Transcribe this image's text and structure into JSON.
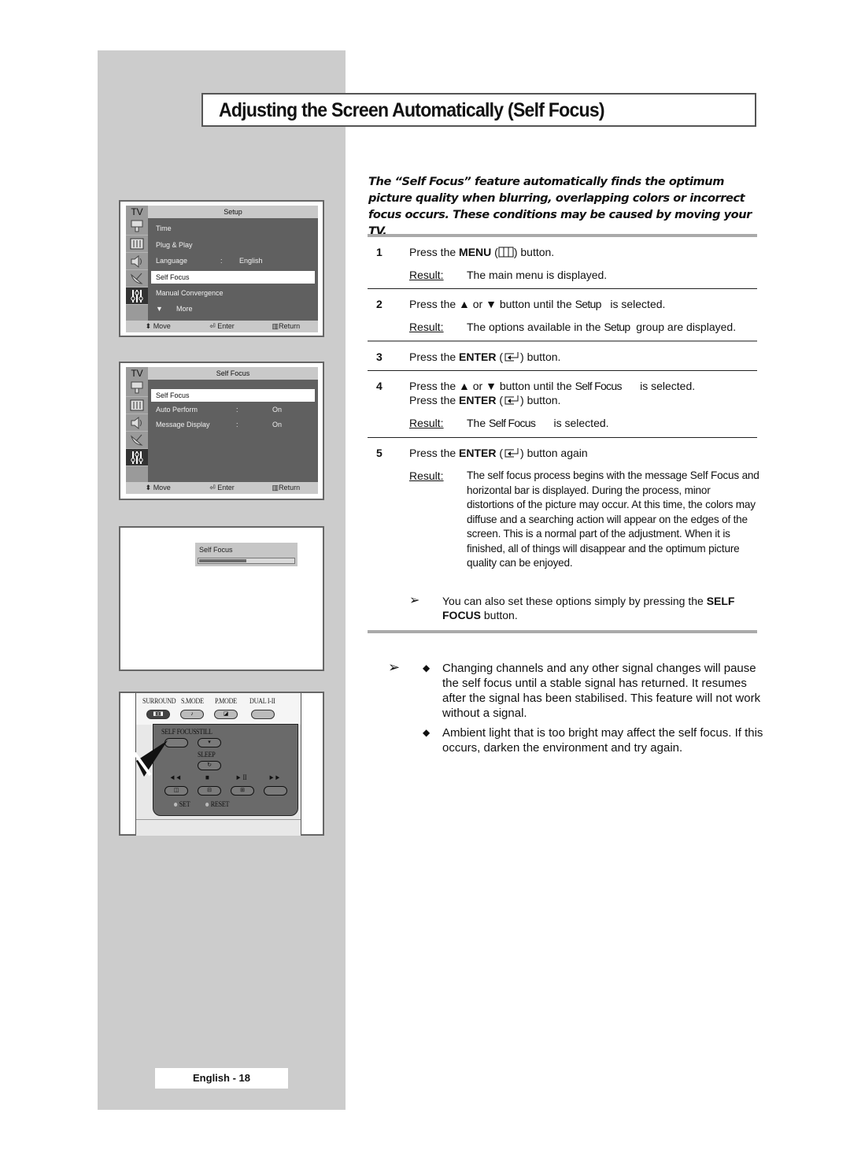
{
  "page": {
    "title": "Adjusting the Screen Automatically (Self Focus)",
    "intro": "The “Self Focus” feature automatically finds the optimum picture quality when blurring, overlapping colors or incorrect focus occurs. These conditions may be caused by moving your TV.",
    "footer": "English - 18"
  },
  "osd_setup": {
    "tv_label": "TV",
    "title": "Setup",
    "icons": [
      "antenna-input-icon",
      "picture-menu-icon",
      "speaker-icon",
      "satellite-dish-icon",
      "sliders-icon"
    ],
    "items": [
      {
        "label": "Time",
        "sep": "",
        "value": ""
      },
      {
        "label": "Plug & Play",
        "sep": "",
        "value": ""
      },
      {
        "label": "Language",
        "sep": ":",
        "value": "English"
      },
      {
        "label": "Self Focus",
        "sep": "",
        "value": "",
        "selected": true
      },
      {
        "label": "Manual Convergence",
        "sep": "",
        "value": ""
      },
      {
        "label": "More",
        "sep": "",
        "value": ""
      }
    ],
    "footer": {
      "move": "Move",
      "enter": "Enter",
      "return": "Return"
    }
  },
  "osd_selffocus": {
    "tv_label": "TV",
    "title": "Self Focus",
    "items": [
      {
        "label": "Self Focus",
        "sep": "",
        "value": "",
        "selected": true
      },
      {
        "label": "Auto Perform",
        "sep": ":",
        "value": "On"
      },
      {
        "label": "Message Display",
        "sep": ":",
        "value": "On"
      }
    ],
    "footer": {
      "move": "Move",
      "enter": "Enter",
      "return": "Return"
    }
  },
  "progress_popup": {
    "label": "Self Focus",
    "progress_percent": 50
  },
  "remote": {
    "top_labels": [
      "SURROUND",
      "S.MODE",
      "P.MODE",
      "DUAL I-II"
    ],
    "self_focus": "SELF FOCUS",
    "still": "STILL",
    "sleep": "SLEEP",
    "transport": [
      "◄◄",
      "■",
      "► II",
      "►►"
    ],
    "set": "SET",
    "reset": "RESET"
  },
  "steps": [
    {
      "num": "1",
      "pre": "Press the ",
      "bold": "MENU",
      "post_icon": "menu-icon",
      "post": ") button.",
      "result_label": "Result:",
      "result": "The main menu is displayed."
    },
    {
      "num": "2",
      "text_a": "Press the ▲ or ▼ button until the ",
      "cond": "Setup",
      "text_b": "   is selected.",
      "result_label": "Result:",
      "result_a": "The options available in the ",
      "result_cond": "Setup",
      "result_b": "  group are displayed."
    },
    {
      "num": "3",
      "pre": "Press the ",
      "bold": "ENTER",
      "post": ") button."
    },
    {
      "num": "4",
      "text_a": "Press the ▲ or ▼ button until the ",
      "cond": "Self Focus",
      "text_b": "      is selected.",
      "line2_pre": "Press the ",
      "line2_bold": "ENTER",
      "line2_post": ") button.",
      "result_label": "Result:",
      "result_a": "The ",
      "result_cond": "Self Focus",
      "result_b": "      is selected."
    },
    {
      "num": "5",
      "pre": "Press the ",
      "bold": "ENTER",
      "post": ") button again",
      "result_label": "Result:",
      "result": "The self focus process begins with the message Self Focus  and horizontal bar is displayed. During the process, minor distortions of the picture may occur. At this time, the colors may diffuse and a searching action will appear on the edges of the screen. This is a normal part of the adjustment. When it is finished, all of things will disappear and the optimum picture quality can be enjoyed."
    }
  ],
  "note": {
    "text": "You can also set these options simply by pressing the ",
    "bold": "SELF FOCUS",
    "post": " button."
  },
  "bullets": [
    "Changing channels and any other signal changes will pause the self focus until a stable signal has returned. It resumes after the signal has been stabilised. This feature will not work without a signal.",
    "Ambient light that is too bright may affect the self focus. If this occurs, darken the environment and try again."
  ],
  "symbols": {
    "open_paren": "(",
    "arrow": "➢",
    "diamond": "◆",
    "down_tri": "▼",
    "updown": "⬍"
  }
}
